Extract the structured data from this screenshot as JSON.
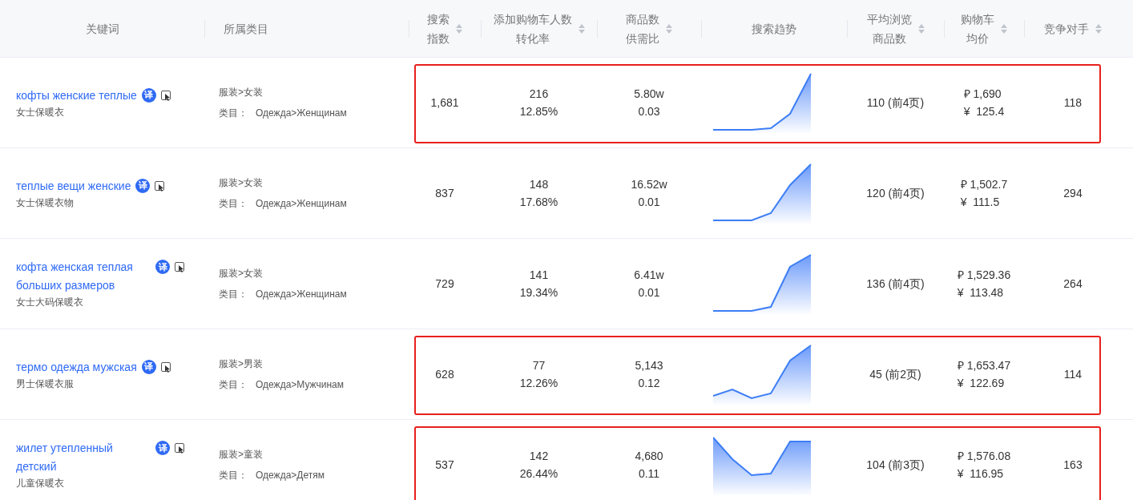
{
  "columns": [
    {
      "lines": [
        "关键词"
      ],
      "sortable": false
    },
    {
      "lines": [
        "所属类目"
      ],
      "sortable": false
    },
    {
      "lines": [
        "搜索",
        "指数"
      ],
      "sortable": true
    },
    {
      "lines": [
        "添加购物车人数",
        "转化率"
      ],
      "sortable": true
    },
    {
      "lines": [
        "商品数",
        "供需比"
      ],
      "sortable": true
    },
    {
      "lines": [
        "搜索趋势"
      ],
      "sortable": false
    },
    {
      "lines": [
        "平均浏览",
        "商品数"
      ],
      "sortable": true
    },
    {
      "lines": [
        "购物车",
        "均价"
      ],
      "sortable": true
    },
    {
      "lines": [
        "竞争对手"
      ],
      "sortable": true
    }
  ],
  "rows": [
    {
      "keyword": "кофты женские теплые",
      "badge": "译",
      "translation": "女士保暖衣",
      "category": "服装>女装",
      "category_label": "类目：",
      "category_ru": "Одежда>Женщинам",
      "search_index": "1,681",
      "add_to_cart": "216",
      "conversion": "12.85%",
      "products": "5.80w",
      "supply_demand": "0.03",
      "avg_browse": "110 (前4页)",
      "price_rub": "₽ 1,690",
      "price_cny": "¥  125.4",
      "competitors": "118",
      "highlighted": true
    },
    {
      "keyword": "теплые вещи женские",
      "badge": "译",
      "translation": "女士保暖衣物",
      "category": "服装>女装",
      "category_label": "类目：",
      "category_ru": "Одежда>Женщинам",
      "search_index": "837",
      "add_to_cart": "148",
      "conversion": "17.68%",
      "products": "16.52w",
      "supply_demand": "0.01",
      "avg_browse": "120 (前4页)",
      "price_rub": "₽ 1,502.7",
      "price_cny": "¥  111.5",
      "competitors": "294",
      "highlighted": false
    },
    {
      "keyword": "кофта женская теплая больших размеров",
      "badge": "译",
      "translation": "女士大码保暖衣",
      "category": "服装>女装",
      "category_label": "类目：",
      "category_ru": "Одежда>Женщинам",
      "search_index": "729",
      "add_to_cart": "141",
      "conversion": "19.34%",
      "products": "6.41w",
      "supply_demand": "0.01",
      "avg_browse": "136 (前4页)",
      "price_rub": "₽ 1,529.36",
      "price_cny": "¥  113.48",
      "competitors": "264",
      "highlighted": false
    },
    {
      "keyword": "термо одежда мужская",
      "badge": "译",
      "translation": "男士保暖衣服",
      "category": "服装>男装",
      "category_label": "类目：",
      "category_ru": "Одежда>Мужчинам",
      "search_index": "628",
      "add_to_cart": "77",
      "conversion": "12.26%",
      "products": "5,143",
      "supply_demand": "0.12",
      "avg_browse": "45 (前2页)",
      "price_rub": "₽ 1,653.47",
      "price_cny": "¥  122.69",
      "competitors": "114",
      "highlighted": true
    },
    {
      "keyword": "жилет утепленный детский",
      "badge": "译",
      "translation": "儿童保暖衣",
      "category": "服装>童装",
      "category_label": "类目：",
      "category_ru": "Одежда>Детям",
      "search_index": "537",
      "add_to_cart": "142",
      "conversion": "26.44%",
      "products": "4,680",
      "supply_demand": "0.11",
      "avg_browse": "104 (前3页)",
      "price_rub": "₽ 1,576.08",
      "price_cny": "¥  116.95",
      "competitors": "163",
      "highlighted": true
    }
  ]
}
